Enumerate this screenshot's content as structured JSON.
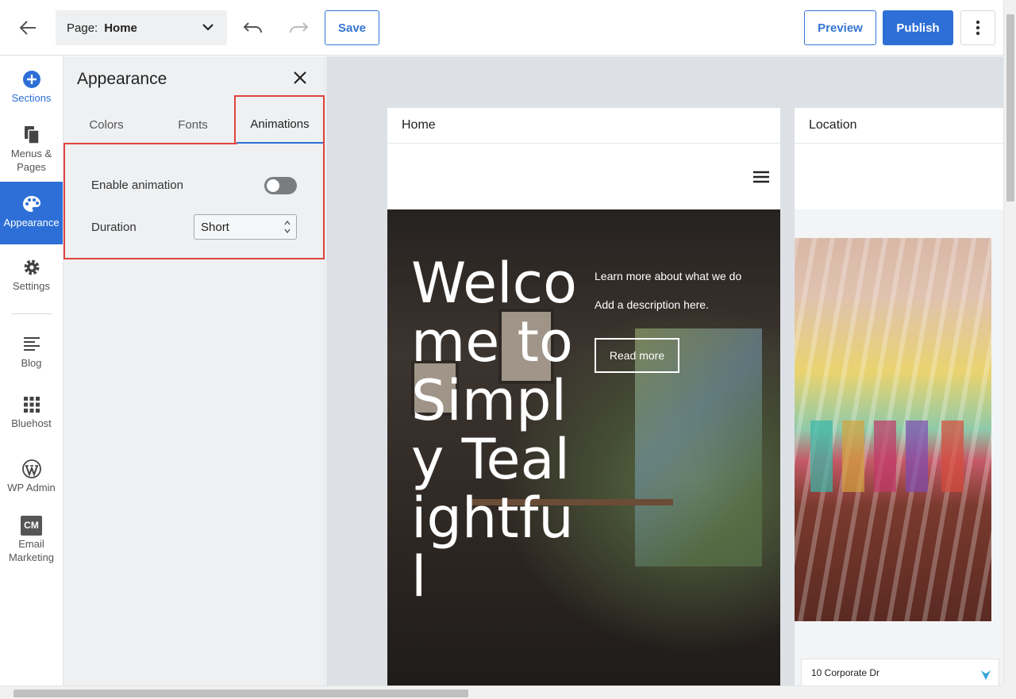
{
  "topbar": {
    "page_label": "Page:",
    "page_value": "Home",
    "save_label": "Save",
    "preview_label": "Preview",
    "publish_label": "Publish"
  },
  "leftnav": {
    "items": [
      {
        "label_line1": "Sections",
        "label_line2": "",
        "icon": "plus-circle-icon"
      },
      {
        "label_line1": "Menus &",
        "label_line2": "Pages",
        "icon": "pages-icon"
      },
      {
        "label_line1": "Appearance",
        "label_line2": "",
        "icon": "palette-icon"
      },
      {
        "label_line1": "Settings",
        "label_line2": "",
        "icon": "gear-icon"
      },
      {
        "label_line1": "Blog",
        "label_line2": "",
        "icon": "blog-icon"
      },
      {
        "label_line1": "Bluehost",
        "label_line2": "",
        "icon": "grid-icon"
      },
      {
        "label_line1": "WP Admin",
        "label_line2": "",
        "icon": "wordpress-icon"
      },
      {
        "label_line1": "Email",
        "label_line2": "Marketing",
        "icon": "cm-icon"
      }
    ],
    "cm_badge": "CM"
  },
  "panel": {
    "title": "Appearance",
    "tabs": [
      "Colors",
      "Fonts",
      "Animations"
    ],
    "active_tab": "Animations",
    "enable_animation_label": "Enable animation",
    "enable_animation_on": false,
    "duration_label": "Duration",
    "duration_value": "Short"
  },
  "canvas": {
    "home_card": {
      "header": "Home",
      "hero_title": "Welcome to Simply Tealightful",
      "hero_sub1": "Learn more about what we do",
      "hero_sub2": "Add a description here.",
      "hero_button": "Read more"
    },
    "location_card": {
      "header": "Location",
      "address": "10 Corporate Dr"
    }
  },
  "colors": {
    "accent": "#2d6fd6",
    "highlight": "#e0443e",
    "panel_bg": "#eef0f2",
    "canvas_bg": "#dde1e5"
  }
}
